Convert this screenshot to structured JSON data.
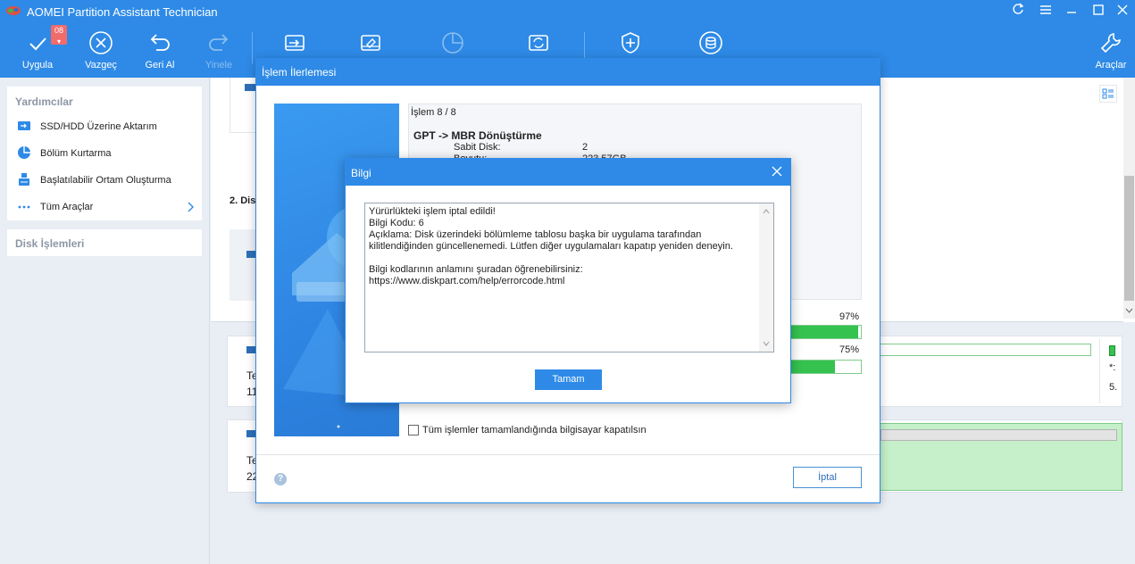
{
  "app": {
    "title": "AOMEI Partition Assistant Technician"
  },
  "toolbar": {
    "apply_label": "Uygula",
    "apply_badge": "08",
    "discard_label": "Vazgeç",
    "undo_label": "Geri Al",
    "redo_label": "Yinele",
    "tools_label": "Araçlar"
  },
  "sidebar": {
    "helpers_title": "Yardımcılar",
    "items": [
      {
        "label": "SSD/HDD Üzerine Aktarım",
        "icon": "disk-copy-icon"
      },
      {
        "label": "Bölüm Kurtarma",
        "icon": "pie-recover-icon"
      },
      {
        "label": "Başlatılabilir Ortam Oluşturma",
        "icon": "bootable-media-icon"
      },
      {
        "label": "Tüm Araçlar",
        "icon": "more-dots-icon"
      }
    ],
    "disk_ops_title": "Disk İşlemleri"
  },
  "main": {
    "disk2_label": "2. Disk",
    "frag_te_1": "Te",
    "frag_num_1": "11",
    "frag_te_2": "Te",
    "frag_num_2": "22",
    "right_frag_1": "*:",
    "right_frag_2": "5."
  },
  "progress_dialog": {
    "title": "İşlem İlerlemesi",
    "step": "İşlem 8 / 8",
    "operation": "GPT -> MBR Dönüştürme",
    "fields": [
      {
        "key": "Sabit Disk:",
        "value": "2"
      },
      {
        "key": "Boyutu:",
        "value": "223.57GB"
      }
    ],
    "progress1": 97,
    "progress1_label": "97%",
    "progress2": 75,
    "progress2_label": "75%",
    "shutdown_checkbox": "Tüm işlemler tamamlandığında bilgisayar kapatılsın",
    "cancel_label": "İptal"
  },
  "info_dialog": {
    "title": "Bilgi",
    "lines": [
      "Yürürlükteki işlem iptal edildi!",
      "Bilgi Kodu: 6",
      "Açıklama: Disk üzerindeki bölümleme tablosu başka bir uygulama tarafından kilitlendiğinden güncellenemedi. Lütfen diğer uygulamaları kapatıp yeniden deneyin.",
      "",
      "Bilgi kodlarının anlamını şuradan öğrenebilirsiniz:",
      "https://www.diskpart.com/help/errorcode.html"
    ],
    "ok_label": "Tamam"
  },
  "colors": {
    "accent": "#2e8ae6",
    "progress": "#35c24f",
    "badge": "#f26b6b"
  }
}
